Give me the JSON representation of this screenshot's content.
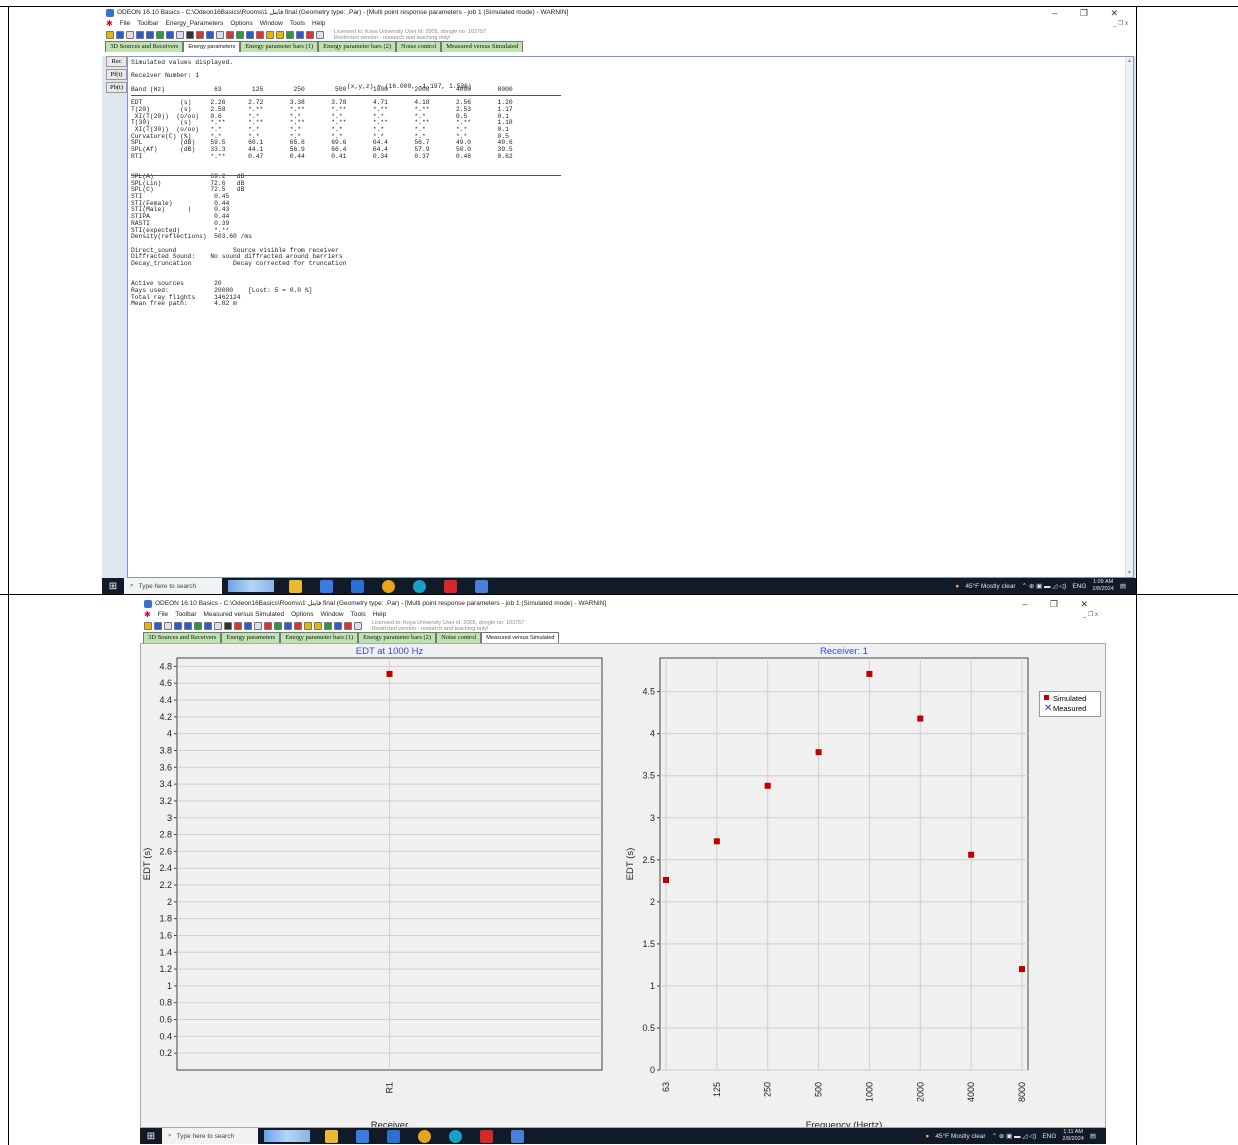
{
  "top": {
    "title": "ODEON 16.10 Basics - C:\\Odeon16Basics\\Rooms\\1 فاینل final (Geometry type: .Par) - [Multi point response parameters - job 1 (Simulated mode) - WARNIN]",
    "menu": [
      "File",
      "Toolbar",
      "Energy_Parameters",
      "Options",
      "Window",
      "Tools",
      "Help"
    ],
    "license": [
      "Licensed to: Koya University  User id: 2005, dongle no: 103757",
      "Restricted version - research and teaching only!"
    ],
    "tabs": [
      "3D Sources and Receivers",
      "Energy parameters",
      "Energy parameter bars (1)",
      "Energy parameter bars (2)",
      "Noise control",
      "Measured versus Simulated"
    ],
    "active_tab": 1,
    "side_buttons": [
      "Rec",
      "Pf(t)",
      "Pb(t)"
    ],
    "report_lines": [
      "Simulated values displayed.",
      "",
      "Receiver Number: 1 ",
      "",
      "Band (Hz)             63        125        250        500       1000       2000       4000       8000",
      "",
      "EDT          (s)     2.26      2.72       3.38       3.78       4.71       4.18       2.56       1.20",
      "T(20)        (s)     2.58      *.**       *.**       *.**       *.**       *.**       2.53       1.17",
      " XI(T(20))  (o/oo)   0.6       *.*        *.*        *.*        *.*        *.*        0.5        0.1",
      "T(30)        (s)     *.**      *.**       *.**       *.**       *.**       *.**       *.**       1.18",
      " XI(T(30))  (o/oo)   *.*       *.*        *.*        *.*        *.*        *.*        *.*        0.1",
      "Curvature(C) (%)     *.*       *.*        *.*        *.*        *.*        *.*        *.*        0.5",
      "SPL          (dB)    59.5      60.1       65.6       69.6       64.4       56.7       49.0       40.6",
      "SPL(Af)      (dB)    33.3      44.1       56.9       66.4       64.4       57.9       50.0       39.5",
      "RTI                  *.**      0.47       0.44       0.41       0.34       0.37       0.48       0.62",
      "",
      "",
      "SPL(A)               69.2   dB",
      "SPL(Lin)             72.6   dB",
      "SPL(C)               72.5   dB",
      "STI                   0.45",
      "STI(Female)           0.44",
      "STI(Male)      |      0.43",
      "STIPA                 0.44",
      "RASTI                 0.39",
      "STI(expected)         *.**",
      "Density(reflections)  503.60 /ms",
      "",
      "Direct_sound               Source visible from receiver",
      "Diffracted Sound:    No sound diffracted around barriers",
      "Decay_truncation           Decay corrected for truncation",
      "",
      "",
      "Active sources        20",
      "Rays used:            20000    [Lost: 5 = 0.0 %]",
      "Total ray flights     1462124",
      "Mean free path:       4.82 m"
    ],
    "coords": "(x,y,z) = (16.000, -1.197, 1.536)",
    "taskbar": {
      "search": "Type here to search",
      "weather": "45°F  Mostly clear",
      "lang": "ENG",
      "time": "1:09 AM",
      "date": "2/8/2024"
    }
  },
  "bottom": {
    "title": "ODEON 16.10 Basics - C:\\Odeon16Basics\\Rooms\\1 فاینل final (Geometry type: .Par) - [Multi point response parameters - job 1 (Simulated mode) - WARNIN]",
    "menu": [
      "File",
      "Toolbar",
      "Measured versus Simulated",
      "Options",
      "Window",
      "Tools",
      "Help"
    ],
    "license": [
      "Licensed to: Koya University  User id: 2005, dongle no: 103757",
      "Restricted version - research and teaching only!"
    ],
    "tabs": [
      "3D Sources and Receivers",
      "Energy parameters",
      "Energy parameter bars (1)",
      "Energy parameter bars (2)",
      "Noise control",
      "Measured versus Simulated"
    ],
    "active_tab": 5,
    "taskbar": {
      "search": "Type here to search",
      "weather": "45°F  Mostly clear",
      "lang": "ENG",
      "time": "1:11 AM",
      "date": "2/8/2024"
    }
  },
  "colors": {
    "tab_green": "#bfe3b0",
    "marker_red": "#c00000",
    "chart_title_blue": "#2e4fd8",
    "taskbar": "#101a28"
  },
  "chart_data": [
    {
      "type": "scatter",
      "title": "EDT at 1000 Hz",
      "xlabel": "Receiver",
      "ylabel": "EDT (s)",
      "categories": [
        "R1"
      ],
      "series": [
        {
          "name": "Simulated",
          "values": [
            4.71
          ]
        }
      ],
      "ylim": [
        0,
        4.9
      ],
      "yticks": [
        "0.2",
        "0.4",
        "0.6",
        "0.8",
        "1",
        "1.2",
        "1.4",
        "1.6",
        "1.8",
        "2",
        "2.2",
        "2.4",
        "2.6",
        "2.8",
        "3",
        "3.2",
        "3.4",
        "3.6",
        "3.8",
        "4",
        "4.2",
        "4.4",
        "4.6",
        "4.8"
      ],
      "grid": true
    },
    {
      "type": "scatter",
      "title": "Receiver: 1",
      "xlabel": "Frequency (Hertz)",
      "ylabel": "EDT (s)",
      "categories": [
        "63",
        "125",
        "250",
        "500",
        "1000",
        "2000",
        "4000",
        "8000"
      ],
      "series": [
        {
          "name": "Simulated",
          "values": [
            2.26,
            2.72,
            3.38,
            3.78,
            4.71,
            4.18,
            2.56,
            1.2
          ]
        },
        {
          "name": "Measured",
          "values": []
        }
      ],
      "ylim": [
        0,
        4.9
      ],
      "yticks": [
        "0",
        "0.5",
        "1",
        "1.5",
        "2",
        "2.5",
        "3",
        "3.5",
        "4",
        "4.5"
      ],
      "legend": [
        "Simulated",
        "Measured"
      ],
      "legend_position": "right",
      "grid": true
    }
  ]
}
